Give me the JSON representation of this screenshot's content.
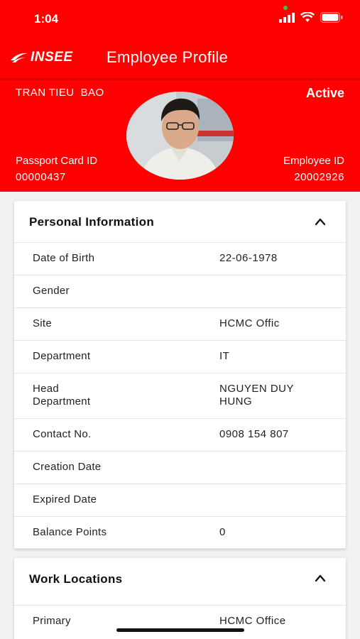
{
  "status_bar": {
    "time": "1:04",
    "icons": [
      "signal-icon",
      "wifi-icon",
      "battery-icon"
    ]
  },
  "header": {
    "logo_text": "INSEE",
    "title": "Employee Profile"
  },
  "employee": {
    "name": "TRAN TIEU  BAO",
    "status": "Active",
    "passport_label": "Passport Card ID",
    "passport_id": "00000437",
    "employee_id_label": "Employee ID",
    "employee_id": "20002926"
  },
  "personal": {
    "title": "Personal Information",
    "rows": [
      {
        "label": "Date of Birth",
        "value": "22-06-1978"
      },
      {
        "label": "Gender",
        "value": ""
      },
      {
        "label": "Site",
        "value": "HCMC Offic"
      },
      {
        "label": "Department",
        "value": "IT"
      },
      {
        "label": "Head\nDepartment",
        "value": "NGUYEN DUY\nHUNG"
      },
      {
        "label": "Contact No.",
        "value": "0908 154 807"
      },
      {
        "label": "Creation Date",
        "value": ""
      },
      {
        "label": "Expired Date",
        "value": ""
      },
      {
        "label": "Balance Points",
        "value": "0"
      }
    ]
  },
  "work": {
    "title": "Work Locations",
    "rows": [
      {
        "label": "Primary",
        "value": "HCMC Office"
      }
    ]
  },
  "colors": {
    "brand_red": "#fe0000",
    "background": "#f2f2f2"
  }
}
